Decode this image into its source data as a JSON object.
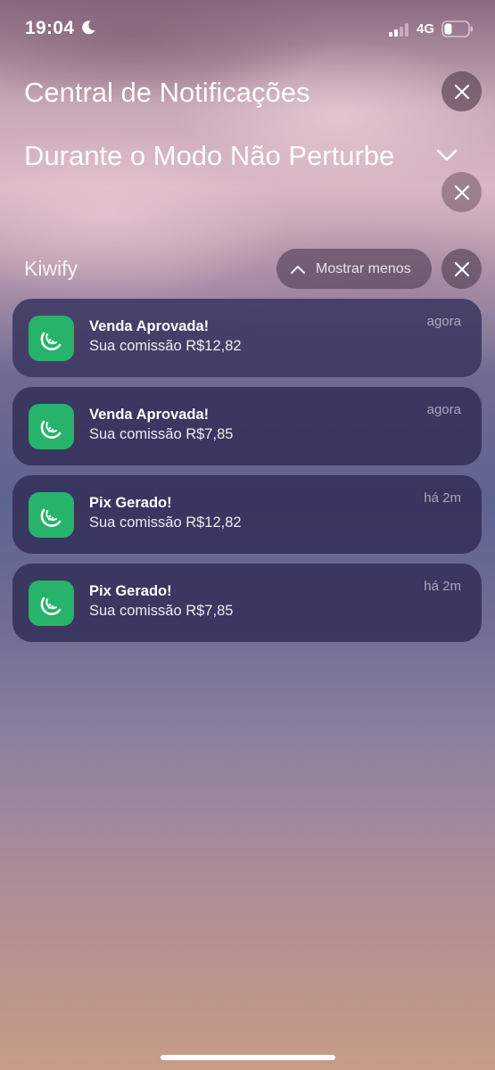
{
  "status_bar": {
    "time": "19:04",
    "network": "4G",
    "icons": [
      "moon-icon",
      "signal-icon",
      "battery-icon"
    ]
  },
  "header": {
    "title": "Central de Notificações",
    "subtitle": "Durante o Modo Não Perturbe"
  },
  "group": {
    "name": "Kiwify",
    "show_less_label": "Mostrar menos"
  },
  "notifications": [
    {
      "title": "Venda Aprovada!",
      "body": "Sua comissão R$12,82",
      "time": "agora"
    },
    {
      "title": "Venda Aprovada!",
      "body": "Sua comissão R$7,85",
      "time": "agora"
    },
    {
      "title": "Pix Gerado!",
      "body": "Sua comissão R$12,82",
      "time": "há 2m"
    },
    {
      "title": "Pix Gerado!",
      "body": "Sua comissão R$7,85",
      "time": "há 2m"
    }
  ],
  "colors": {
    "app_icon": "#27b36b",
    "card": "#322e58"
  }
}
